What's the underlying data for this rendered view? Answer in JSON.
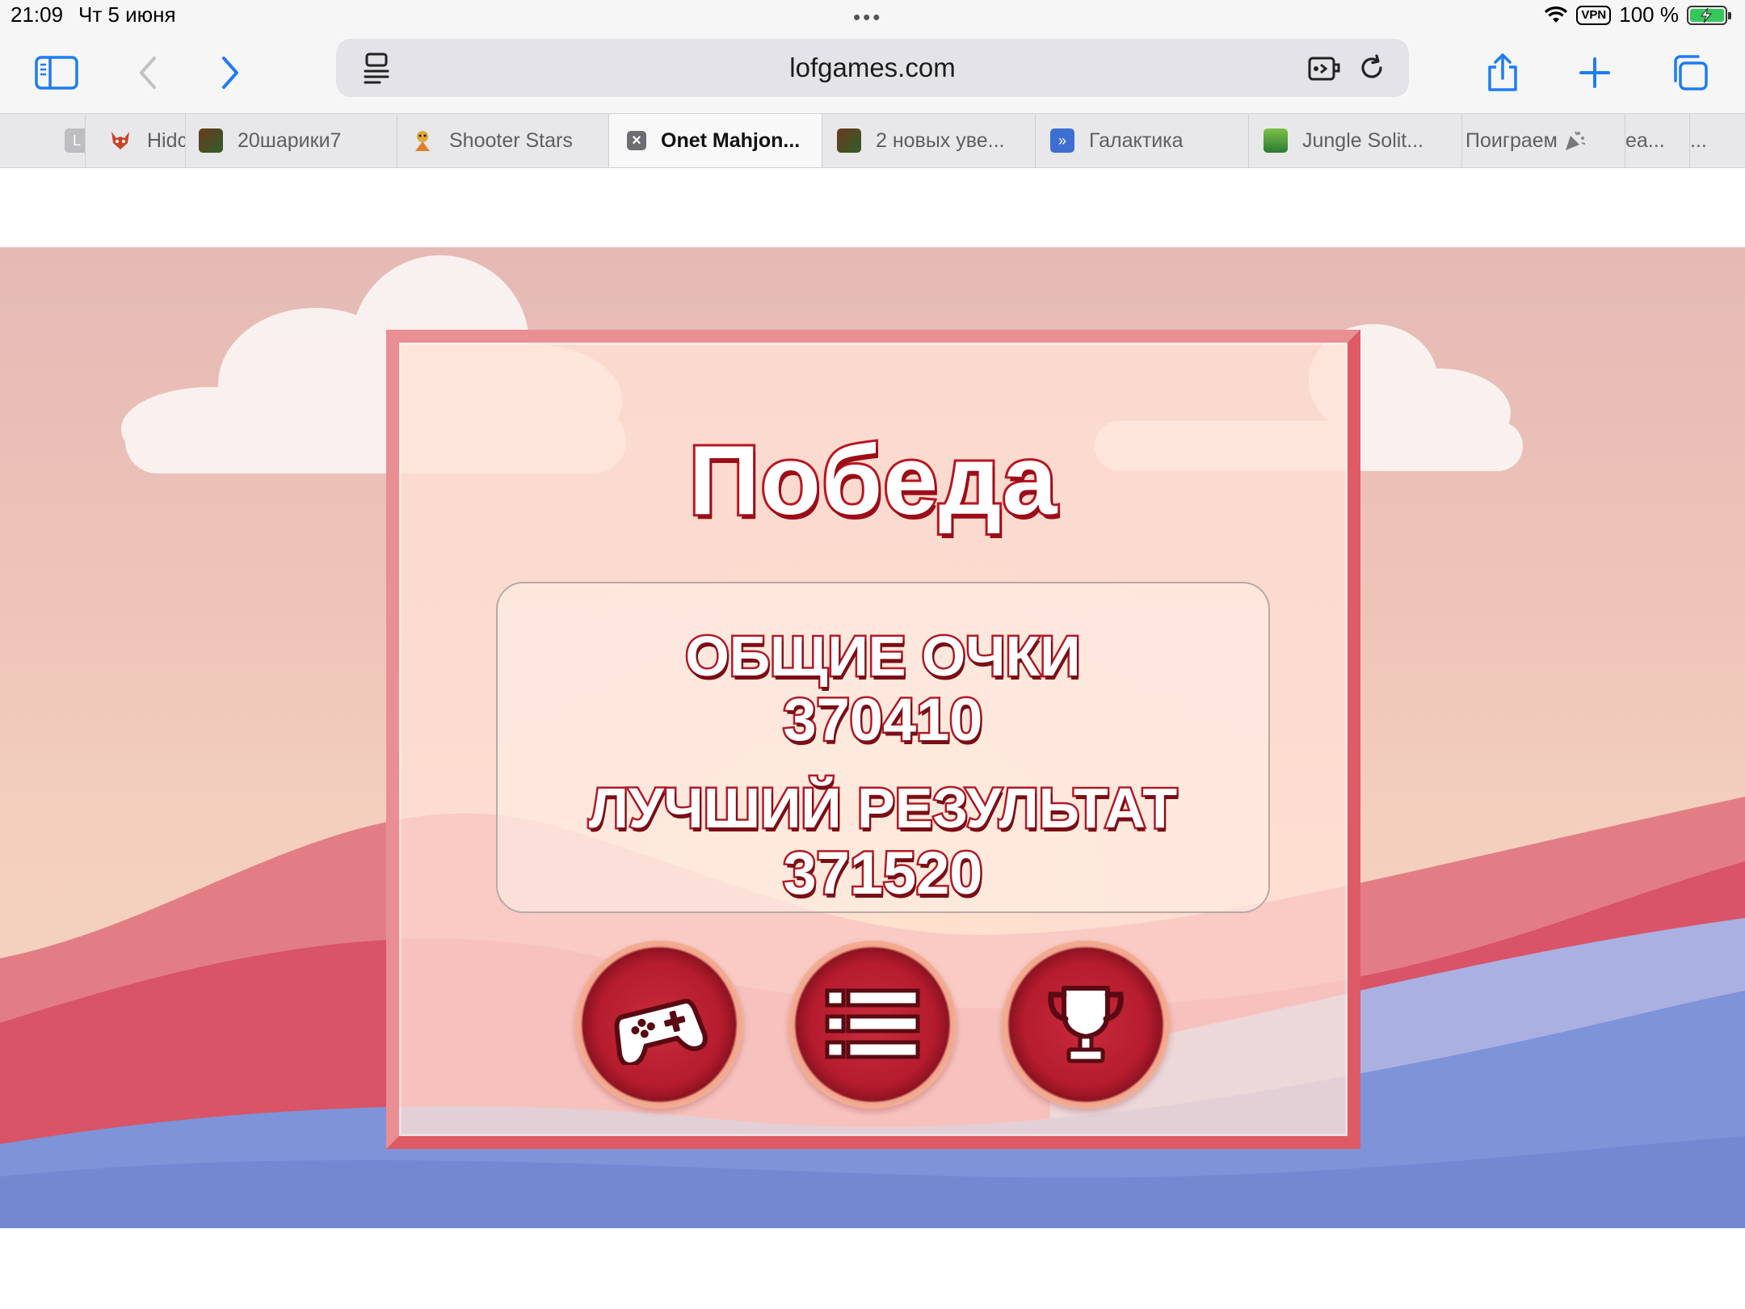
{
  "status_bar": {
    "time": "21:09",
    "date": "Чт 5 июня",
    "dots": "•••",
    "vpn": "VPN",
    "battery": "100 %"
  },
  "toolbar": {
    "url": "lofgames.com"
  },
  "tabs": [
    {
      "label": "L",
      "favicon": "letter-l-icon"
    },
    {
      "label": "Hidc",
      "favicon": "fox-icon"
    },
    {
      "label": "20шарики7",
      "favicon": "game-thumbnail-icon"
    },
    {
      "label": "Shooter Stars",
      "favicon": "character-icon"
    },
    {
      "label": "Onet Mahjon...",
      "favicon": "close-icon",
      "active": true
    },
    {
      "label": "2 новых уве...",
      "favicon": "game-thumbnail-icon"
    },
    {
      "label": "Галактика",
      "favicon": "galaxy-icon"
    },
    {
      "label": "Jungle Solit...",
      "favicon": "jungle-icon"
    },
    {
      "label": "Поиграем",
      "favicon": "party-popper-icon"
    },
    {
      "label": "ea...",
      "favicon": ""
    },
    {
      "label": "...",
      "favicon": ""
    }
  ],
  "game": {
    "title": "Победа",
    "total_label": "ОБЩИЕ ОЧКИ",
    "total_value": "370410",
    "best_label": "ЛУЧШИЙ РЕЗУЛЬТАТ",
    "best_value": "371520",
    "buttons": [
      "gamepad-icon",
      "list-icon",
      "trophy-icon"
    ]
  },
  "colors": {
    "accent": "#1e7cf2",
    "panel_border": "#e98e93",
    "title_stroke": "#b81622",
    "button_red": "#b51c2e"
  }
}
